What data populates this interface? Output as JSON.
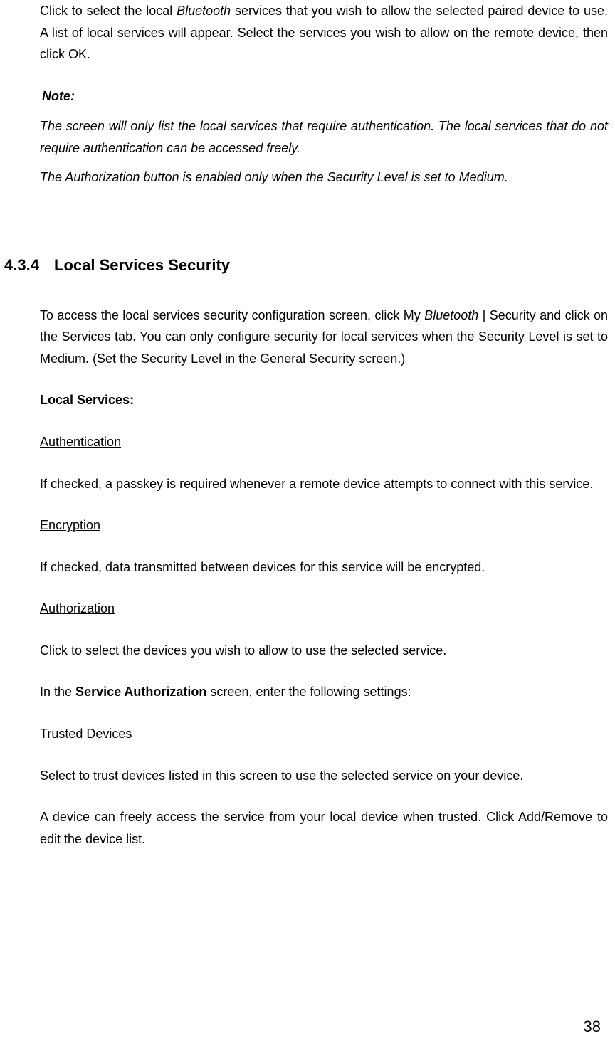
{
  "intro": {
    "text_before_italic": "Click to select the local ",
    "italic_word": "Bluetooth",
    "text_after_italic": " services that you wish to allow the selected paired device to use. A list of local services will appear. Select the services you wish to allow on the remote device, then click OK."
  },
  "note": {
    "label": "Note:",
    "para1": "The screen will only list the local services that require authentication. The local services that do not require authentication can be accessed freely.",
    "para2": "The Authorization button is enabled only when the Security Level is set to Medium."
  },
  "section": {
    "number": "4.3.4",
    "title": "Local Services Security",
    "intro_before": "To access the local services security configuration screen, click My ",
    "intro_italic": "Bluetooth",
    "intro_after": " | Security and click on the Services tab. You can only configure security for local services when the Security Level is set to Medium. (Set the Security Level in the General Security screen.)",
    "local_services_label": "Local Services:",
    "authentication": {
      "heading": "Authentication",
      "text": "If checked, a passkey is required whenever a remote device attempts to connect with this service."
    },
    "encryption": {
      "heading": "Encryption",
      "text": "If checked, data transmitted between devices for this service will be encrypted."
    },
    "authorization": {
      "heading": "Authorization",
      "text": "Click to select the devices you wish to allow to use the selected service.",
      "settings_before": "In the ",
      "settings_bold": "Service Authorization",
      "settings_after": " screen, enter the following settings:"
    },
    "trusted_devices": {
      "heading": "Trusted Devices",
      "text1": "Select to trust devices listed in this screen to use the selected service on your device.",
      "text2": "A device can freely access the service from your local device when trusted. Click Add/Remove to edit the device list."
    }
  },
  "page_number": "38"
}
